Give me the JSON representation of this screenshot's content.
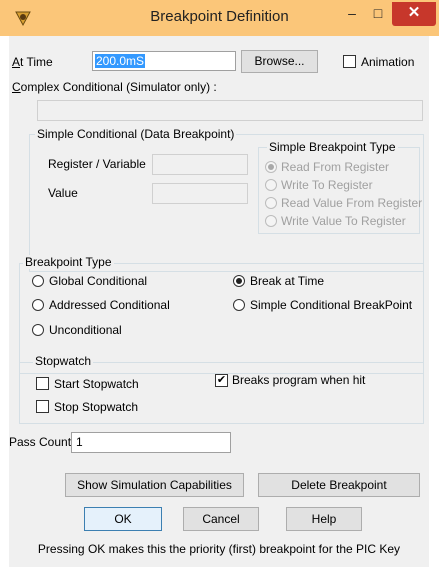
{
  "window": {
    "title": "Breakpoint Definition",
    "minimize_glyph": "–",
    "maximize_glyph": "□",
    "close_glyph": "✕",
    "app_icon": "bug-app-icon"
  },
  "at_time": {
    "label_u": "A",
    "label_rest": "t Time",
    "value": "200.0mS",
    "browse_label": "Browse...",
    "animation_label": "Animation",
    "animation_checked": false
  },
  "complex": {
    "label_u": "C",
    "label_rest": "omplex Conditional  (Simulator only) :",
    "value": ""
  },
  "simple_conditional": {
    "legend": "Simple Conditional (Data Breakpoint)",
    "register_label": "Register / Variable",
    "register_value": "",
    "value_label": "Value",
    "value_value": "",
    "type_legend": "Simple Breakpoint Type",
    "types": [
      "Read From Register",
      "Write To Register",
      "Read Value From Register",
      "Write Value To Register"
    ],
    "selected_type": 0
  },
  "breakpoint_type": {
    "legend": "Breakpoint Type",
    "options": [
      "Global Conditional",
      "Addressed Conditional",
      "Unconditional",
      "Break at Time",
      "Simple Conditional BreakPoint"
    ],
    "selected": 3
  },
  "stopwatch": {
    "legend": "Stopwatch",
    "start_label": "Start Stopwatch",
    "start_checked": false,
    "stop_label": "Stop Stopwatch",
    "stop_checked": false,
    "breaks_label": "Breaks program when hit",
    "breaks_checked": true
  },
  "pass_count": {
    "label": "Pass Count",
    "value": "1"
  },
  "buttons": {
    "show_sim": "Show Simulation Capabilities",
    "delete": "Delete Breakpoint",
    "ok": "OK",
    "cancel": "Cancel",
    "help": "Help"
  },
  "footer": "Pressing OK makes this the priority (first) breakpoint for the PIC Key",
  "colors": {
    "titlebar": "#fbc679",
    "close_button": "#c7372b",
    "dialog_bg": "#f0f0f0",
    "selection": "#3399ff"
  }
}
